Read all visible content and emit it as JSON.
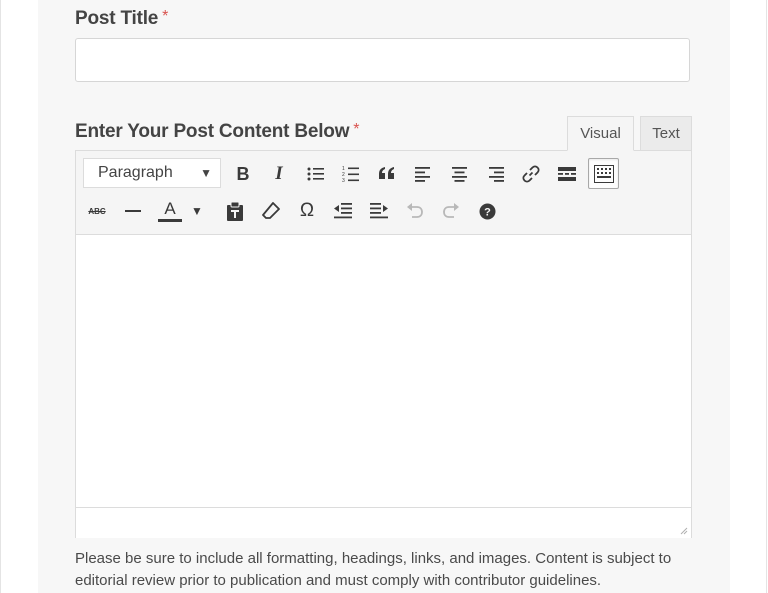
{
  "post_title": {
    "label": "Post Title",
    "required_mark": "*",
    "value": "",
    "placeholder": ""
  },
  "content": {
    "label": "Enter Your Post Content Below",
    "required_mark": "*",
    "tabs": [
      {
        "label": "Visual",
        "active": true
      },
      {
        "label": "Text",
        "active": false
      }
    ],
    "format_select": {
      "selected": "Paragraph"
    },
    "toolbar_row1": [
      "bold-icon",
      "italic-icon",
      "bullet-list-icon",
      "numbered-list-icon",
      "blockquote-icon",
      "align-left-icon",
      "align-center-icon",
      "align-right-icon",
      "link-icon",
      "read-more-icon",
      "toolbar-toggle-icon"
    ],
    "toolbar_row2": [
      "strikethrough-icon",
      "horizontal-line-icon",
      "text-color-icon",
      "paste-as-text-icon",
      "clear-formatting-icon",
      "special-character-icon",
      "outdent-icon",
      "indent-icon",
      "undo-icon",
      "redo-icon",
      "help-icon"
    ],
    "glyphs": {
      "bold": "B",
      "italic": "I",
      "text_color": "A",
      "strike": "ABC",
      "omega": "Ω",
      "caret": "▼"
    },
    "body": ""
  },
  "help_text": "Please be sure to include all formatting, headings, links, and images. Content is subject to editorial review prior to publication and must comply with contributor guidelines.",
  "colors": {
    "required": "#d9534f",
    "panel_bg": "#f7f7f7",
    "toolbar_bg": "#f5f5f5",
    "border": "#dcdcdc"
  }
}
